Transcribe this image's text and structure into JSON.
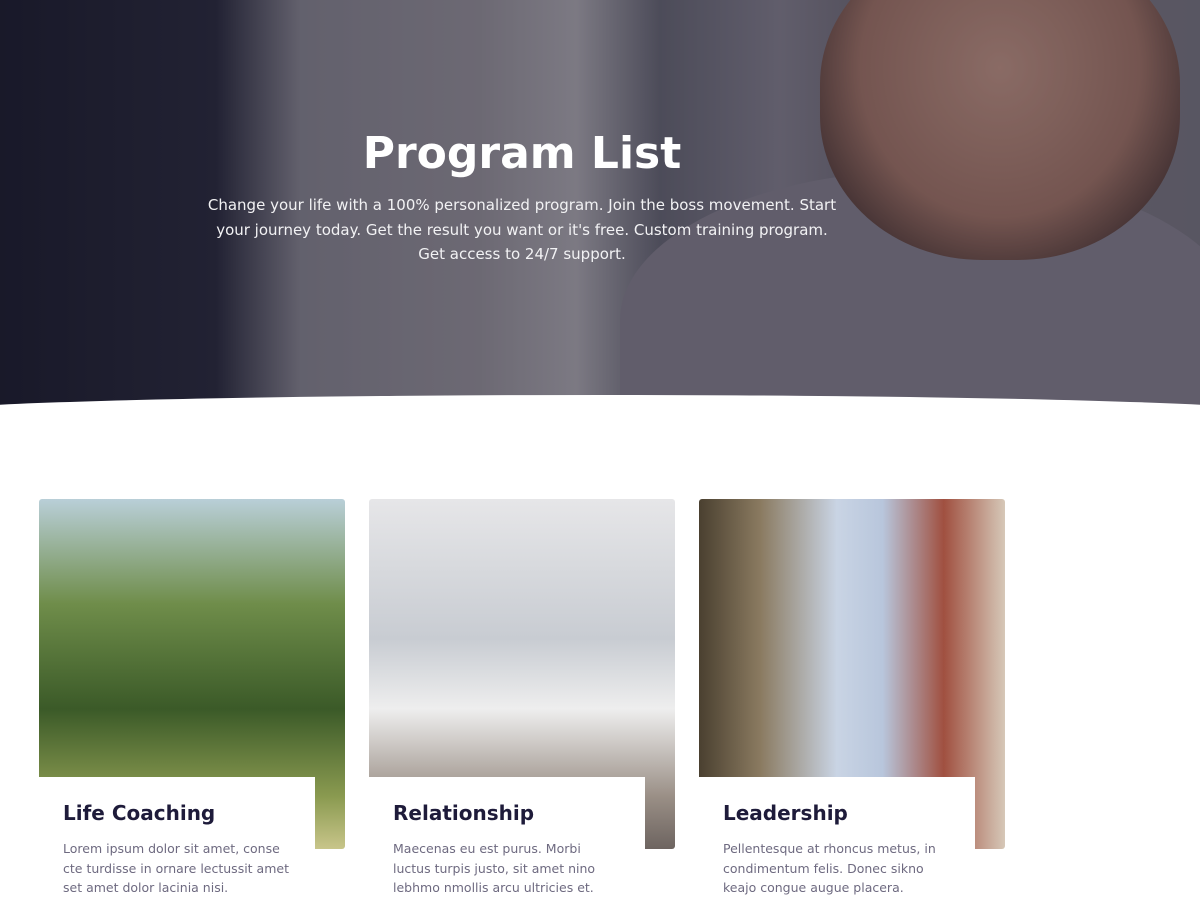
{
  "hero": {
    "title": "Program List",
    "subtitle": "Change your life with a 100% personalized program. Join the boss movement. Start your journey today. Get the result you want or it's free. Custom training program. Get access to 24/7 support."
  },
  "programs": [
    {
      "title": "Life Coaching",
      "description": "Lorem ipsum dolor sit amet, conse cte turdisse in ornare lectussit amet set amet dolor lacinia nisi."
    },
    {
      "title": "Relationship",
      "description": "Maecenas eu est purus. Morbi luctus turpis justo, sit amet nino lebhmo nmollis arcu ultricies et."
    },
    {
      "title": "Leadership",
      "description": "Pellentesque at rhoncus metus, in condimentum felis. Donec sikno keajo congue augue placera."
    }
  ]
}
